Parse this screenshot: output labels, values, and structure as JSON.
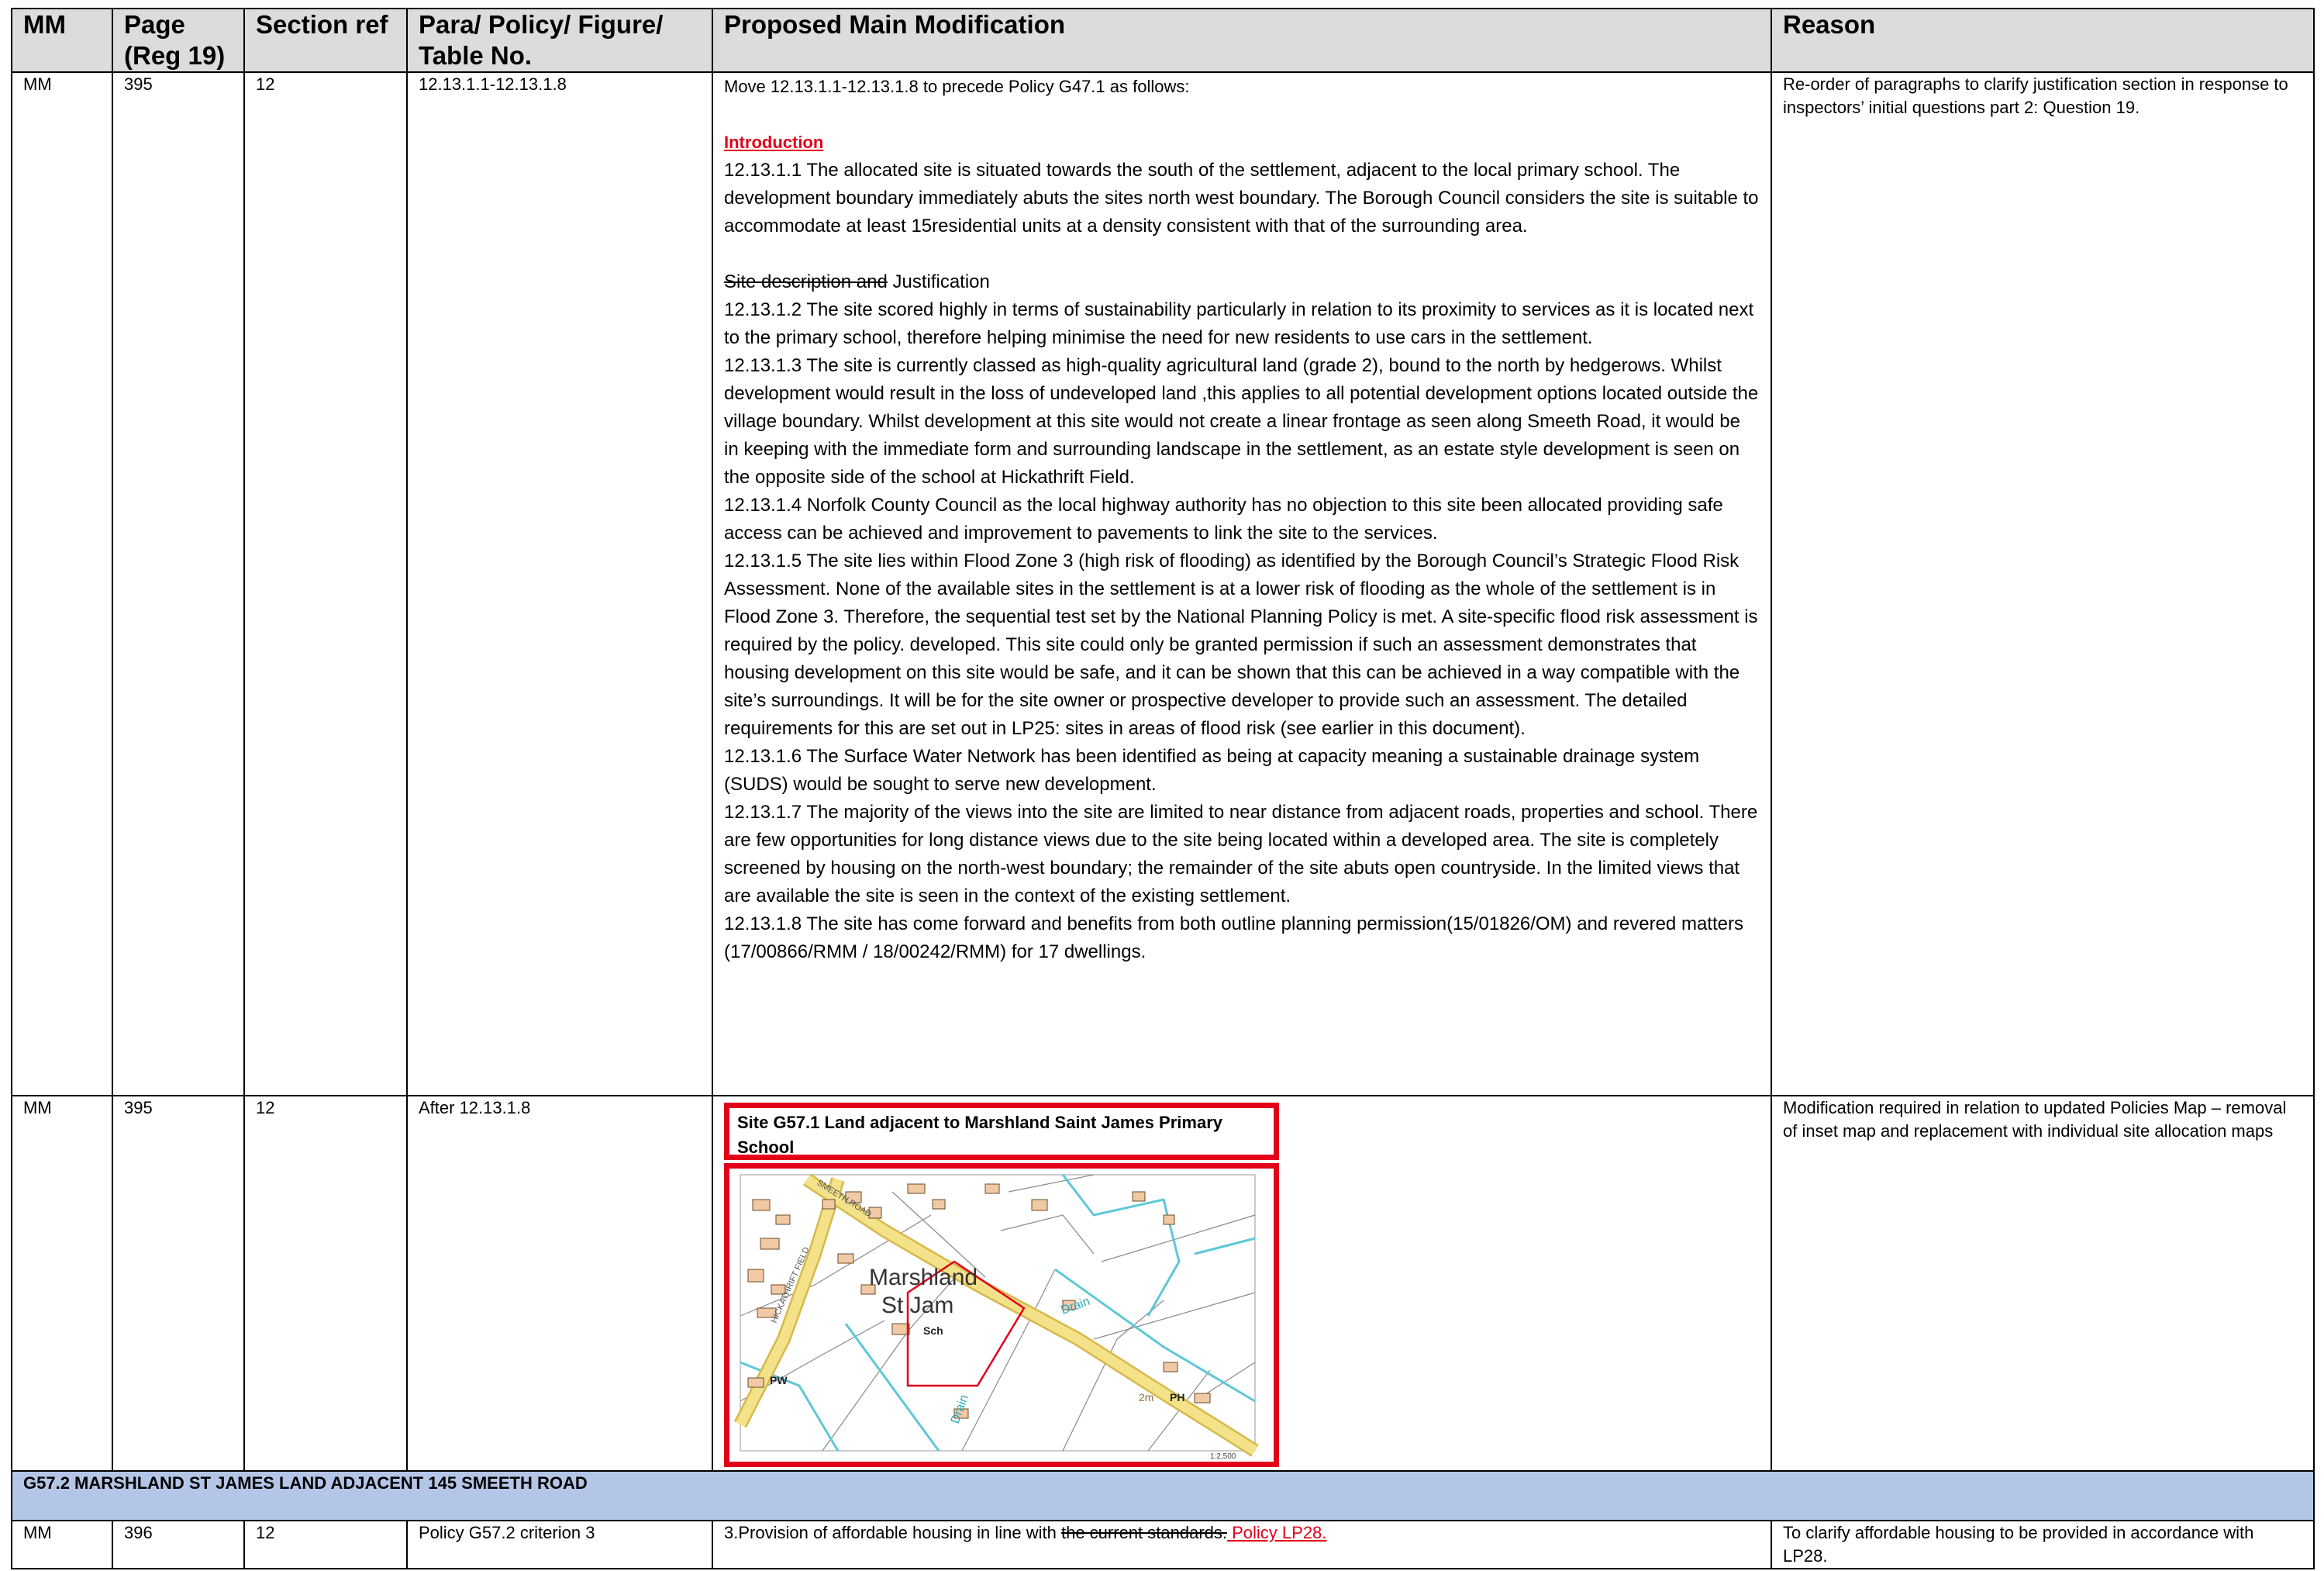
{
  "headers": {
    "mm": "MM",
    "page": "Page (Reg 19)",
    "section": "Section ref",
    "para": "Para/ Policy/ Figure/ Table No.",
    "main": "Proposed Main Modification",
    "reason": "Reason"
  },
  "row1": {
    "mm": "MM",
    "page": "395",
    "section": "12",
    "para": "12.13.1.1-12.13.1.8",
    "intro_line": "Move 12.13.1.1-12.13.1.8 to precede Policy G47.1 as follows:",
    "introduction_heading": "Introduction",
    "p1": "12.13.1.1 The allocated site is situated towards the south of the settlement, adjacent to the local primary school. The development boundary immediately abuts the sites north west boundary. The Borough Council considers the site is suitable to accommodate at least 15residential units at a density consistent with that of the surrounding area.",
    "just_deleted": "Site description and",
    "just_heading": " Justification",
    "p2": "12.13.1.2 The site scored highly in terms of sustainability particularly in relation to its proximity to services as it is located next to the primary school, therefore helping minimise the need for new residents to use cars in the settlement.",
    "p3": "12.13.1.3 The site is currently classed as high-quality agricultural land (grade 2), bound to the north by hedgerows. Whilst development would result in the loss of undeveloped land ,this applies to all potential development options located outside the village boundary. Whilst development at this site would not create a linear frontage as seen along Smeeth Road, it would be in keeping with the immediate form and surrounding landscape in the settlement, as an estate style development is seen on the opposite side of the school at Hickathrift Field.",
    "p4": "12.13.1.4 Norfolk County Council as the local highway authority has no objection to this site been allocated providing safe access can be achieved and improvement to pavements to link the site to the services.",
    "p5": "12.13.1.5 The site lies within Flood Zone 3 (high risk of flooding) as identified by the Borough Council’s Strategic Flood Risk Assessment. None of the available sites in the settlement is at a lower risk of flooding as the whole of the settlement is in Flood Zone 3. Therefore, the sequential test set by the National Planning Policy is met. A site-specific flood risk assessment is required by the policy. developed. This site could only be granted permission if such an assessment demonstrates that housing development on this site would be safe, and it can be shown that this can be achieved in a way compatible with the site’s surroundings. It will be for the site owner or prospective developer to provide such an assessment. The detailed requirements for this are set out in LP25: sites in areas of flood risk (see earlier in this document).",
    "p6": "12.13.1.6 The Surface Water Network has been identified as being at capacity meaning a sustainable drainage system (SUDS) would be sought to serve new development.",
    "p7": "12.13.1.7 The majority of the views into the site are limited to near distance from adjacent roads, properties and school. There are few opportunities for long distance views due to the site being located within a developed area. The site is completely screened by housing on the north-west boundary; the remainder of the site abuts open countryside. In the limited views that are available the site is seen in the context of the existing settlement.",
    "p8": "12.13.1.8 The site has come forward and benefits from both outline planning permission(15/01826/OM) and revered matters (17/00866/RMM / 18/00242/RMM) for 17 dwellings.",
    "reason": "Re-order of paragraphs to clarify justification section in response to inspectors’ initial questions part 2: Question 19."
  },
  "row2": {
    "mm": "MM",
    "page": "395",
    "section": "12",
    "para": "After 12.13.1.8",
    "site_title": "Site G57.1 Land adjacent to Marshland Saint James Primary School",
    "map": {
      "place_line1": "Marshland",
      "place_line2": "St Jam",
      "drain_1": "Drain",
      "drain_2": "Drain",
      "label_pw": "PW",
      "label_ph": "PH",
      "label_sch": "Sch",
      "label_2m": "2m",
      "road_1": "SMEETH ROAD",
      "road_2": "HICKATHRIFT FIELD",
      "scale": "1:2,500"
    },
    "reason": "Modification required in relation to updated Policies Map – removal of inset map and replacement with individual site allocation maps"
  },
  "section_header": "G57.2 MARSHLAND ST JAMES LAND ADJACENT 145 SMEETH ROAD",
  "row3": {
    "mm": "MM",
    "page": "396",
    "section": "12",
    "para": "Policy G57.2 criterion 3",
    "text_before": "3.Provision of affordable housing in line with ",
    "text_deleted": "the current standards.",
    "text_inserted": " Policy LP28.",
    "reason": "To clarify affordable housing to be provided in accordance with LP28."
  },
  "colors": {
    "header_bg": "#dcdcdc",
    "section_bg": "#b4c6e7",
    "red": "#e2001a",
    "road_yellow": "#f3e28a",
    "water_blue": "#5ec8d8",
    "building_orange": "#f1c9a4"
  }
}
